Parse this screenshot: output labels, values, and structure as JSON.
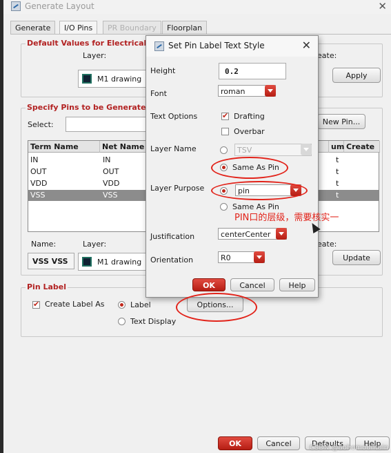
{
  "main_window": {
    "title": "Generate Layout",
    "tabs": [
      "Generate",
      "I/O Pins",
      "PR Boundary",
      "Floorplan"
    ],
    "default_values_group": {
      "title": "Default Values for Electrical Pi",
      "layer_label": "Layer:",
      "layer_value": "M1 drawing",
      "create_label": "eate:",
      "apply_button": "Apply"
    },
    "specify_pins_group": {
      "title": "Specify Pins to be Generated",
      "select_label": "Select:",
      "new_pin_button": "New Pin...",
      "table": {
        "headers": [
          "Term Name",
          "Net Name",
          "um",
          "Create"
        ],
        "rows": [
          {
            "term": "IN",
            "net": "IN",
            "create": "t"
          },
          {
            "term": "OUT",
            "net": "OUT",
            "create": "t"
          },
          {
            "term": "VDD",
            "net": "VDD",
            "create": "t"
          },
          {
            "term": "VSS",
            "net": "VSS",
            "create": "t"
          }
        ]
      },
      "name_label": "Name:",
      "name_value": "VSS VSS",
      "layer_label": "Layer:",
      "layer_value": "M1 drawing",
      "create_label": "eate:",
      "update_button": "Update"
    },
    "pin_label_group": {
      "title": "Pin Label",
      "create_label_as": "Create Label As",
      "label_option": "Label",
      "text_display_option": "Text Display",
      "options_button": "Options..."
    },
    "bottom_buttons": {
      "ok": "OK",
      "cancel": "Cancel",
      "defaults": "Defaults",
      "help": "Help"
    }
  },
  "dialog": {
    "title": "Set Pin Label Text Style",
    "height_label": "Height",
    "height_value": "0.2",
    "font_label": "Font",
    "font_value": "roman",
    "text_options_label": "Text Options",
    "drafting_label": "Drafting",
    "overbar_label": "Overbar",
    "layer_name_label": "Layer Name",
    "layer_name_value": "TSV",
    "same_as_pin_1": "Same As Pin",
    "layer_purpose_label": "Layer Purpose",
    "layer_purpose_value": "pin",
    "same_as_pin_2": "Same As Pin",
    "justification_label": "Justification",
    "justification_value": "centerCenter",
    "orientation_label": "Orientation",
    "orientation_value": "R0",
    "ok_button": "OK",
    "cancel_button": "Cancel",
    "help_button": "Help"
  },
  "annotation": {
    "note": "PIN口的层级，需要核实一"
  },
  "watermark": "CSDN @aohomountain",
  "colors": {
    "accent_red": "#b51d13",
    "annotation_red": "#e2231a",
    "group_title_red": "#b22222"
  }
}
